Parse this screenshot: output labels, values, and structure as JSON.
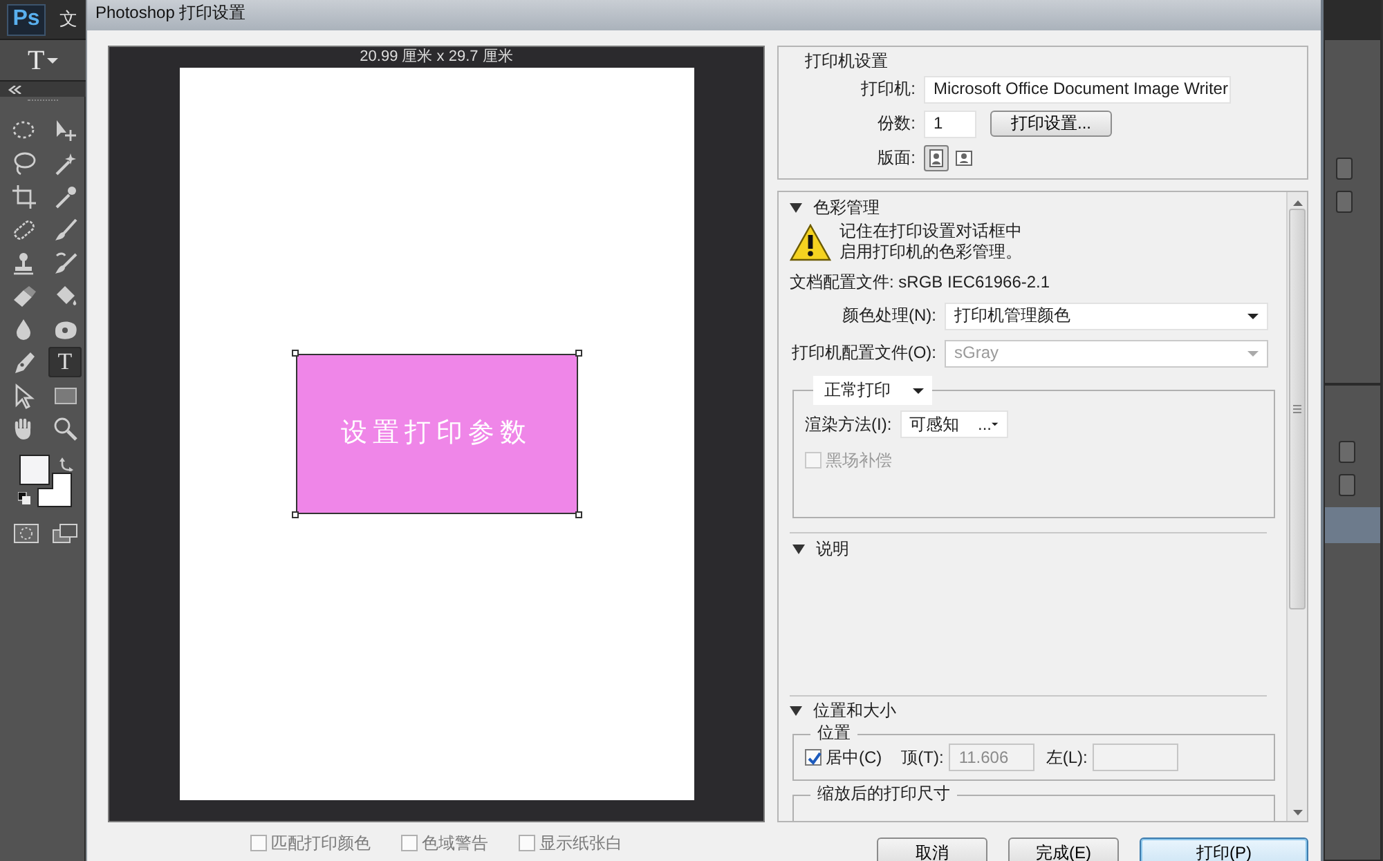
{
  "app": {
    "logo": "Ps",
    "menu_partial": "文",
    "options_tool": "T"
  },
  "tools": [
    {
      "kind": "marquee",
      "selected": false
    },
    {
      "kind": "move",
      "selected": false
    },
    {
      "kind": "lasso",
      "selected": false
    },
    {
      "kind": "wand",
      "selected": false
    },
    {
      "kind": "crop",
      "selected": false
    },
    {
      "kind": "eyedropper",
      "selected": false
    },
    {
      "kind": "bandage",
      "selected": false
    },
    {
      "kind": "brush",
      "selected": false
    },
    {
      "kind": "stamp",
      "selected": false
    },
    {
      "kind": "history_brush",
      "selected": false
    },
    {
      "kind": "eraser",
      "selected": false
    },
    {
      "kind": "bucket",
      "selected": false
    },
    {
      "kind": "drop",
      "selected": false
    },
    {
      "kind": "sponge",
      "selected": false
    },
    {
      "kind": "pen",
      "selected": false
    },
    {
      "kind": "text",
      "label": "T",
      "selected": true
    },
    {
      "kind": "pointer",
      "selected": false
    },
    {
      "kind": "rectangle",
      "selected": false
    },
    {
      "kind": "hand",
      "selected": false
    },
    {
      "kind": "zoom",
      "selected": false
    }
  ],
  "color_swatches": [
    {
      "color": "#f4f4f6"
    },
    {
      "color": "#ffffff"
    }
  ],
  "dialog": {
    "title": "Photoshop 打印设置",
    "preview": {
      "size_label": "20.99 厘米 x 29.7 厘米",
      "artwork_text": "设置打印参数"
    },
    "preview_options": [
      {
        "label": "匹配打印颜色",
        "checked": false
      },
      {
        "label": "色域警告",
        "checked": false
      },
      {
        "label": "显示纸张白",
        "checked": false
      }
    ],
    "printer_settings": {
      "heading": "打印机设置",
      "printer_label": "打印机:",
      "printer_value": "Microsoft Office Document Image Writer",
      "copies_label": "份数:",
      "copies_value": "1",
      "setup_button": "打印设置...",
      "layout_label": "版面:",
      "layouts": [
        {
          "kind": "portrait",
          "selected": true
        },
        {
          "kind": "landscape",
          "selected": false
        }
      ]
    },
    "color_management": {
      "heading": "色彩管理",
      "expanded": true,
      "warning_lines": [
        "记住在打印设置对话框中",
        "启用打印机的色彩管理。"
      ],
      "document_profile": "文档配置文件: sRGB IEC61966-2.1",
      "color_handling": {
        "label": "颜色处理(N):",
        "value": "打印机管理颜色"
      },
      "printer_profile": {
        "label": "打印机配置文件(O):",
        "value": "sGray",
        "disabled": true
      },
      "mode": "正常打印",
      "rendering": {
        "label": "渲染方法(I):",
        "value": "可感知    ..."
      },
      "black_point": {
        "label": "黑场补偿",
        "checked": false,
        "disabled": true
      }
    },
    "description": {
      "heading": "说明",
      "expanded": true
    },
    "position_size": {
      "heading": "位置和大小",
      "expanded": true,
      "position_group": "位置",
      "center": {
        "label": "居中(C)",
        "checked": true
      },
      "top": {
        "label": "顶(T):",
        "value": "11.606",
        "disabled": true
      },
      "left": {
        "label": "左(L):"
      },
      "scaled_heading": "缩放后的打印尺寸"
    },
    "buttons": [
      {
        "label": "取消",
        "default": false
      },
      {
        "label": "完成(E)",
        "default": false
      },
      {
        "label": "打印(P)",
        "default": true
      }
    ]
  }
}
